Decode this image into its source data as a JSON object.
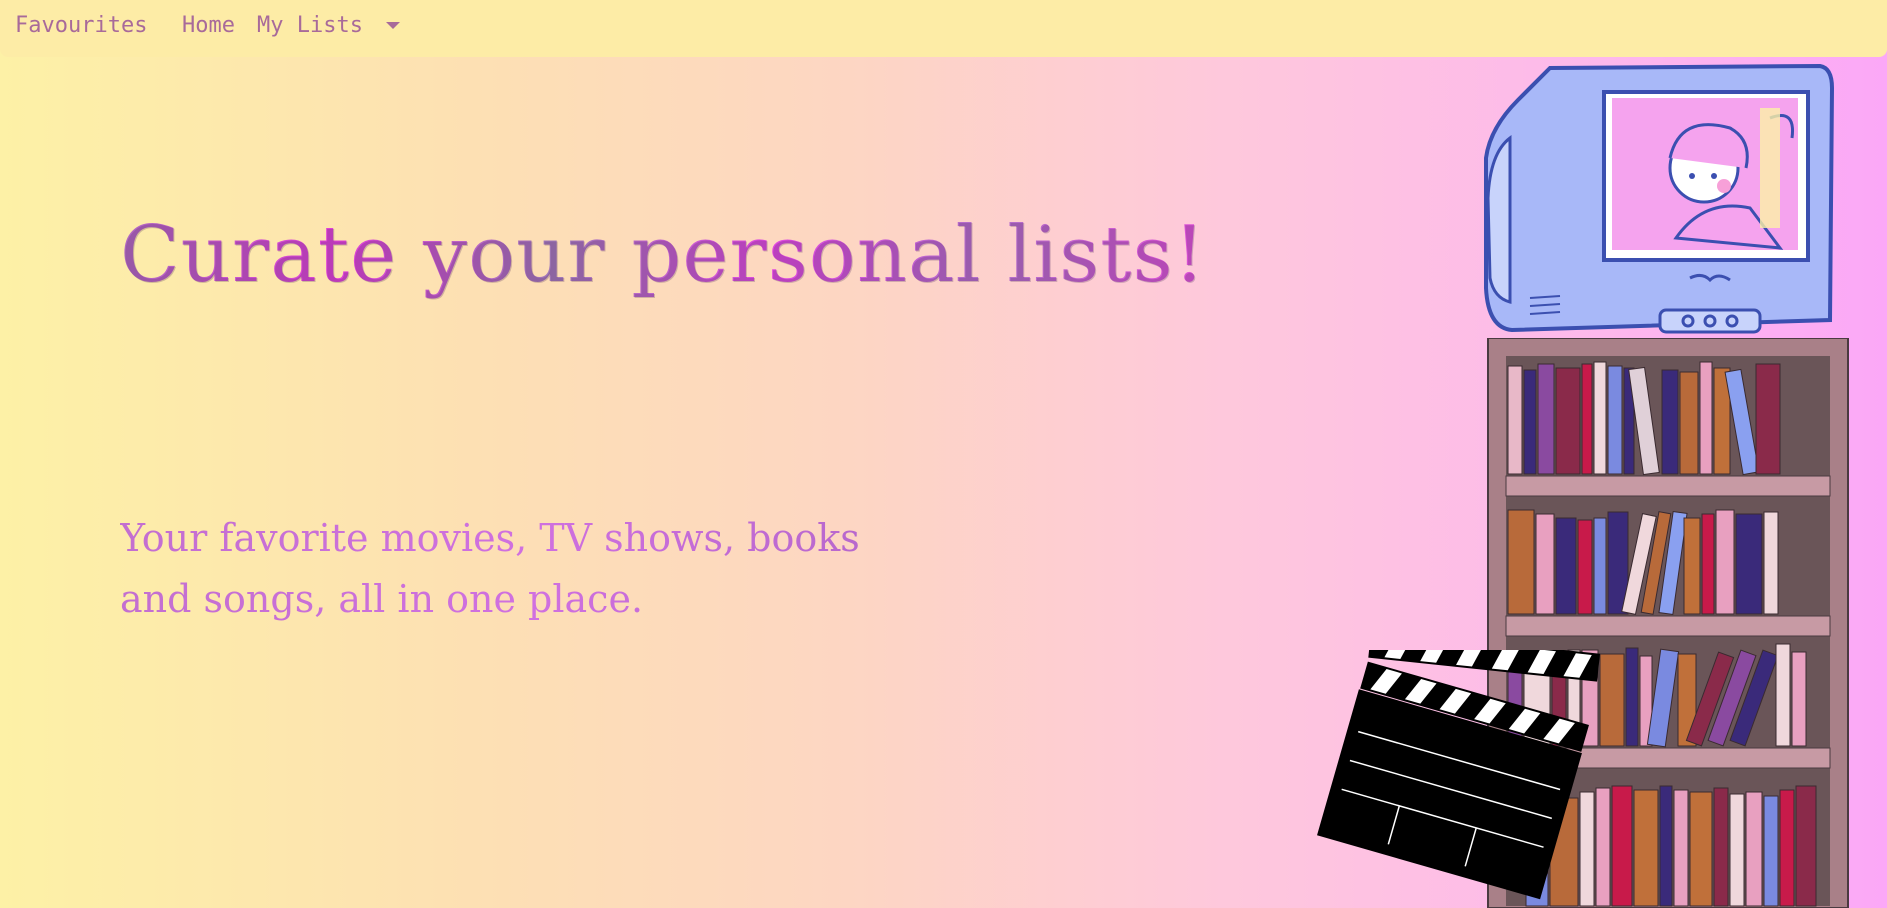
{
  "navbar": {
    "favourites": "Favourites",
    "home": "Home",
    "my_lists": "My Lists"
  },
  "hero": {
    "title": "Curate your personal lists!",
    "subtitle": "Your favorite movies, TV shows, books and songs, all in one place."
  },
  "icons": {
    "dropdown": "chevron-down-icon",
    "tv": "tv-icon",
    "bookshelf": "bookshelf-icon",
    "clapperboard": "clapperboard-icon"
  },
  "colors": {
    "nav_bg": "#fdeca6",
    "nav_text": "#a86a9a",
    "accent_pink": "#e040d8",
    "tv_blue": "#a8b8f8",
    "shelf_wood": "#a98088"
  }
}
